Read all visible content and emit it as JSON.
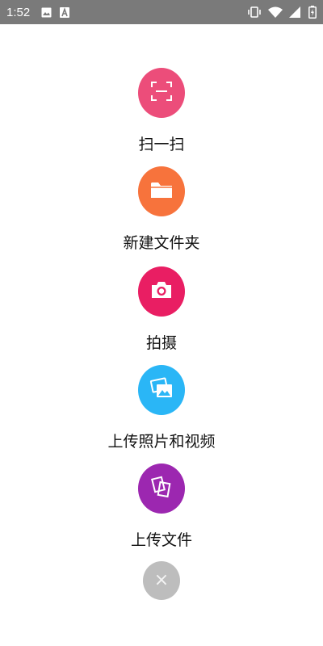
{
  "status_bar": {
    "time": "1:52",
    "left_icons": [
      "image-icon",
      "a-badge-icon"
    ],
    "right_icons": [
      "vibrate-icon",
      "wifi-icon",
      "signal-icon",
      "battery-charging-icon"
    ],
    "background": "#7a7a7a"
  },
  "menu": {
    "items": [
      {
        "label": "扫一扫",
        "icon": "scan-icon",
        "color": "#ec4d7a"
      },
      {
        "label": "新建文件夹",
        "icon": "folder-icon",
        "color": "#f7733c"
      },
      {
        "label": "拍摄",
        "icon": "camera-icon",
        "color": "#e91e63"
      },
      {
        "label": "上传照片和视频",
        "icon": "photos-icon",
        "color": "#2ab6f6"
      },
      {
        "label": "上传文件",
        "icon": "files-icon",
        "color": "#9c27b0"
      }
    ],
    "close": {
      "glyph": "×",
      "icon": "close-icon",
      "color": "#bdbdbd"
    }
  }
}
